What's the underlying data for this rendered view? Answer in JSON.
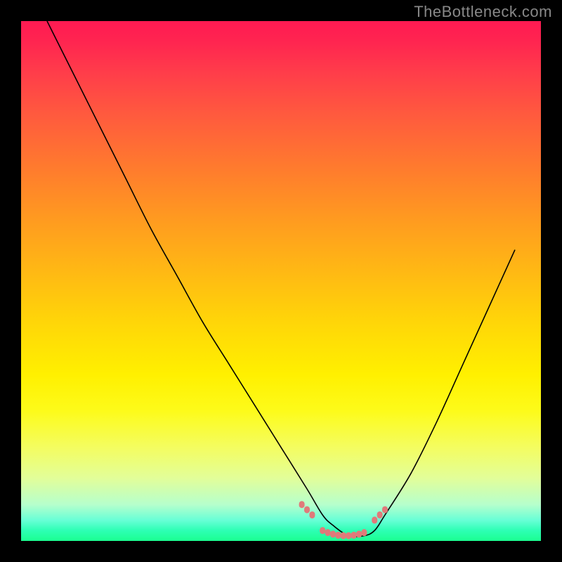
{
  "watermark": "TheBottleneck.com",
  "chart_data": {
    "type": "line",
    "title": "",
    "xlabel": "",
    "ylabel": "",
    "xlim": [
      0,
      100
    ],
    "ylim": [
      0,
      100
    ],
    "series": [
      {
        "name": "bottleneck-curve",
        "x": [
          5,
          10,
          15,
          20,
          25,
          30,
          35,
          40,
          45,
          50,
          55,
          58,
          60,
          63,
          66,
          68,
          70,
          75,
          80,
          85,
          90,
          95
        ],
        "y": [
          100,
          90,
          80,
          70,
          60,
          51,
          42,
          34,
          26,
          18,
          10,
          5,
          3,
          1,
          1,
          2,
          5,
          13,
          23,
          34,
          45,
          56
        ]
      }
    ],
    "markers": {
      "name": "highlight-dots",
      "color": "#e07a7a",
      "groups": [
        {
          "x": [
            54,
            55,
            56
          ],
          "y": [
            7,
            6,
            5
          ]
        },
        {
          "x": [
            58,
            59,
            60,
            61,
            62,
            63,
            64,
            65,
            66
          ],
          "y": [
            2,
            1.6,
            1.3,
            1.1,
            1,
            1,
            1.1,
            1.3,
            1.6
          ]
        },
        {
          "x": [
            68,
            69,
            70
          ],
          "y": [
            4,
            5,
            6
          ]
        }
      ]
    },
    "background": "red-yellow-green-gradient"
  }
}
